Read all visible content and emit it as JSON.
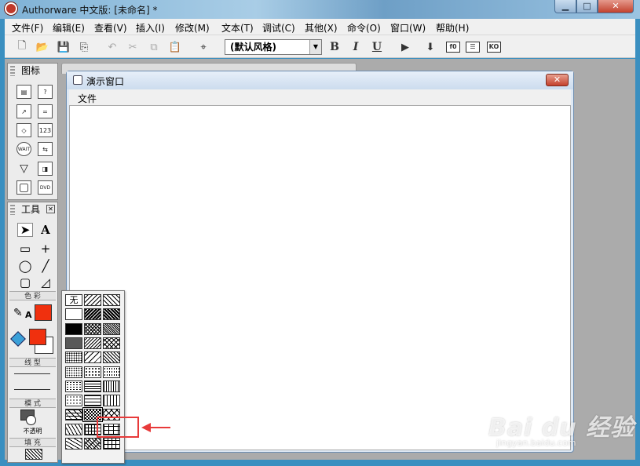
{
  "window": {
    "title": "Authorware 中文版: [未命名] *",
    "min": "▁",
    "max": "□",
    "close": "✕"
  },
  "menubar": [
    {
      "label": "文件(F)"
    },
    {
      "label": "编辑(E)"
    },
    {
      "label": "查看(V)"
    },
    {
      "label": "插入(I)"
    },
    {
      "label": "修改(M)"
    },
    {
      "label": "文本(T)"
    },
    {
      "label": "调试(C)"
    },
    {
      "label": "其他(X)"
    },
    {
      "label": "命令(O)"
    },
    {
      "label": "窗口(W)"
    },
    {
      "label": "帮助(H)"
    }
  ],
  "toolbar": {
    "style_value": "(默认风格)",
    "bold": "B",
    "italic": "I",
    "underline": "U",
    "icons": [
      "new-file-icon",
      "open-folder-icon",
      "save-all-icon",
      "import-icon",
      "undo-icon",
      "cut-icon",
      "copy-icon",
      "paste-icon",
      "find-icon",
      "run-icon",
      "restart-icon",
      "functions-icon",
      "variables-icon",
      "knowledge-objects-icon"
    ]
  },
  "icon_palette": {
    "title": "图标",
    "items": [
      {
        "icon": "display-icon",
        "text": "▤"
      },
      {
        "icon": "question-icon",
        "text": "?"
      },
      {
        "icon": "motion-icon",
        "text": "↗"
      },
      {
        "icon": "decision-icon",
        "text": "="
      },
      {
        "icon": "erase-icon",
        "text": "◇"
      },
      {
        "icon": "calculation-icon",
        "text": "123"
      },
      {
        "icon": "wait-icon",
        "text": "WAIT"
      },
      {
        "icon": "navigate-icon",
        "text": "⇆"
      },
      {
        "icon": "interaction-icon",
        "text": "▽"
      },
      {
        "icon": "framework-icon",
        "text": "◨"
      },
      {
        "icon": "map-icon",
        "text": "▢"
      },
      {
        "icon": "movie-icon",
        "text": "DVD"
      }
    ]
  },
  "tool_palette": {
    "title": "工具",
    "tools": [
      {
        "icon": "pointer-icon",
        "text": "➤"
      },
      {
        "icon": "text-tool-icon",
        "text": "A"
      },
      {
        "icon": "rectangle-tool-icon",
        "text": "▭"
      },
      {
        "icon": "cross-line-tool-icon",
        "text": "+"
      },
      {
        "icon": "ellipse-tool-icon",
        "text": "◯"
      },
      {
        "icon": "diagonal-line-tool-icon",
        "text": "╱"
      },
      {
        "icon": "rounded-rect-tool-icon",
        "text": "▢"
      },
      {
        "icon": "polygon-tool-icon",
        "text": "◿"
      }
    ],
    "color_label": "色 彩",
    "line_label": "线 型",
    "mode_label": "模 式",
    "mode_value": "不透明",
    "fill_label": "填 充",
    "line_color": "#f0300e",
    "fill_fore_color": "#f0300e",
    "fill_back_color": "#ffffff"
  },
  "pattern_popup": {
    "none_label": "无",
    "selected_index": 25,
    "patterns": [
      "none",
      "hatch-back",
      "hatch-fwd",
      "white",
      "hatch-back-dense",
      "hatch-fwd-dense",
      "black",
      "cross-dense",
      "diag-dense",
      "dots-dense",
      "diag-light",
      "diag-cross",
      "dots-medium",
      "diag-back-light",
      "hatch-medium",
      "dots-light",
      "dots-sparse",
      "dots-check",
      "dots-fine",
      "horizontal-dense",
      "vertical-dense",
      "dots-tiny",
      "horizontal-light",
      "vertical-light",
      "brick",
      "checker",
      "diamond-cross",
      "zigzag",
      "grid",
      "trellis",
      "wave",
      "weave",
      "diag-brick"
    ]
  },
  "presentation_window": {
    "title": "演示窗口",
    "menu_file": "文件",
    "close": "✕"
  },
  "watermark": {
    "logo": "Bai du 经验",
    "url": "jingyan.baidu.com"
  }
}
